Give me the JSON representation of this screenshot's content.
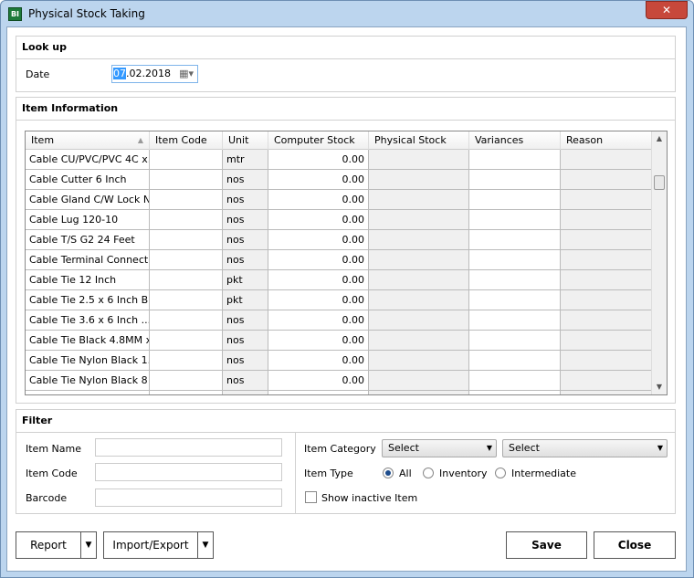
{
  "window": {
    "title": "Physical Stock Taking",
    "app_icon": "BI",
    "close_symbol": "✕"
  },
  "lookup": {
    "title": "Look up",
    "date_label": "Date",
    "date_selected": "07",
    "date_rest": ".02.2018"
  },
  "items": {
    "title": "Item Information",
    "columns": [
      "Item",
      "Item Code",
      "Unit",
      "Computer Stock",
      "Physical Stock",
      "Variances",
      "Reason"
    ],
    "rows": [
      {
        "item": "Cable CU/PVC/PVC 4C x...",
        "code": "",
        "unit": "mtr",
        "stock": "0.00"
      },
      {
        "item": "Cable Cutter 6 Inch",
        "code": "",
        "unit": "nos",
        "stock": "0.00"
      },
      {
        "item": "Cable Gland C/W Lock N...",
        "code": "",
        "unit": "nos",
        "stock": "0.00"
      },
      {
        "item": "Cable Lug 120-10",
        "code": "",
        "unit": "nos",
        "stock": "0.00"
      },
      {
        "item": "Cable T/S G2 24 Feet",
        "code": "",
        "unit": "nos",
        "stock": "0.00"
      },
      {
        "item": "Cable Terminal Connect...",
        "code": "",
        "unit": "nos",
        "stock": "0.00"
      },
      {
        "item": "Cable Tie 12 Inch",
        "code": "",
        "unit": "pkt",
        "stock": "0.00"
      },
      {
        "item": "Cable Tie 2.5 x 6 Inch B...",
        "code": "",
        "unit": "pkt",
        "stock": "0.00"
      },
      {
        "item": "Cable Tie 3.6 x 6 Inch ...",
        "code": "",
        "unit": "nos",
        "stock": "0.00"
      },
      {
        "item": "Cable Tie Black 4.8MM x...",
        "code": "",
        "unit": "nos",
        "stock": "0.00"
      },
      {
        "item": "Cable Tie Nylon Black 1...",
        "code": "",
        "unit": "nos",
        "stock": "0.00"
      },
      {
        "item": "Cable Tie Nylon Black 8 ...",
        "code": "",
        "unit": "nos",
        "stock": "0.00"
      }
    ]
  },
  "filter": {
    "title": "Filter",
    "item_name_label": "Item Name",
    "item_code_label": "Item Code",
    "barcode_label": "Barcode",
    "item_category_label": "Item Category",
    "category_select1": "Select",
    "category_select2": "Select",
    "item_type_label": "Item Type",
    "type_options": [
      "All",
      "Inventory",
      "Intermediate"
    ],
    "type_selected": "All",
    "show_inactive_label": "Show inactive Item"
  },
  "buttons": {
    "report": "Report",
    "import_export": "Import/Export",
    "save": "Save",
    "close": "Close"
  }
}
